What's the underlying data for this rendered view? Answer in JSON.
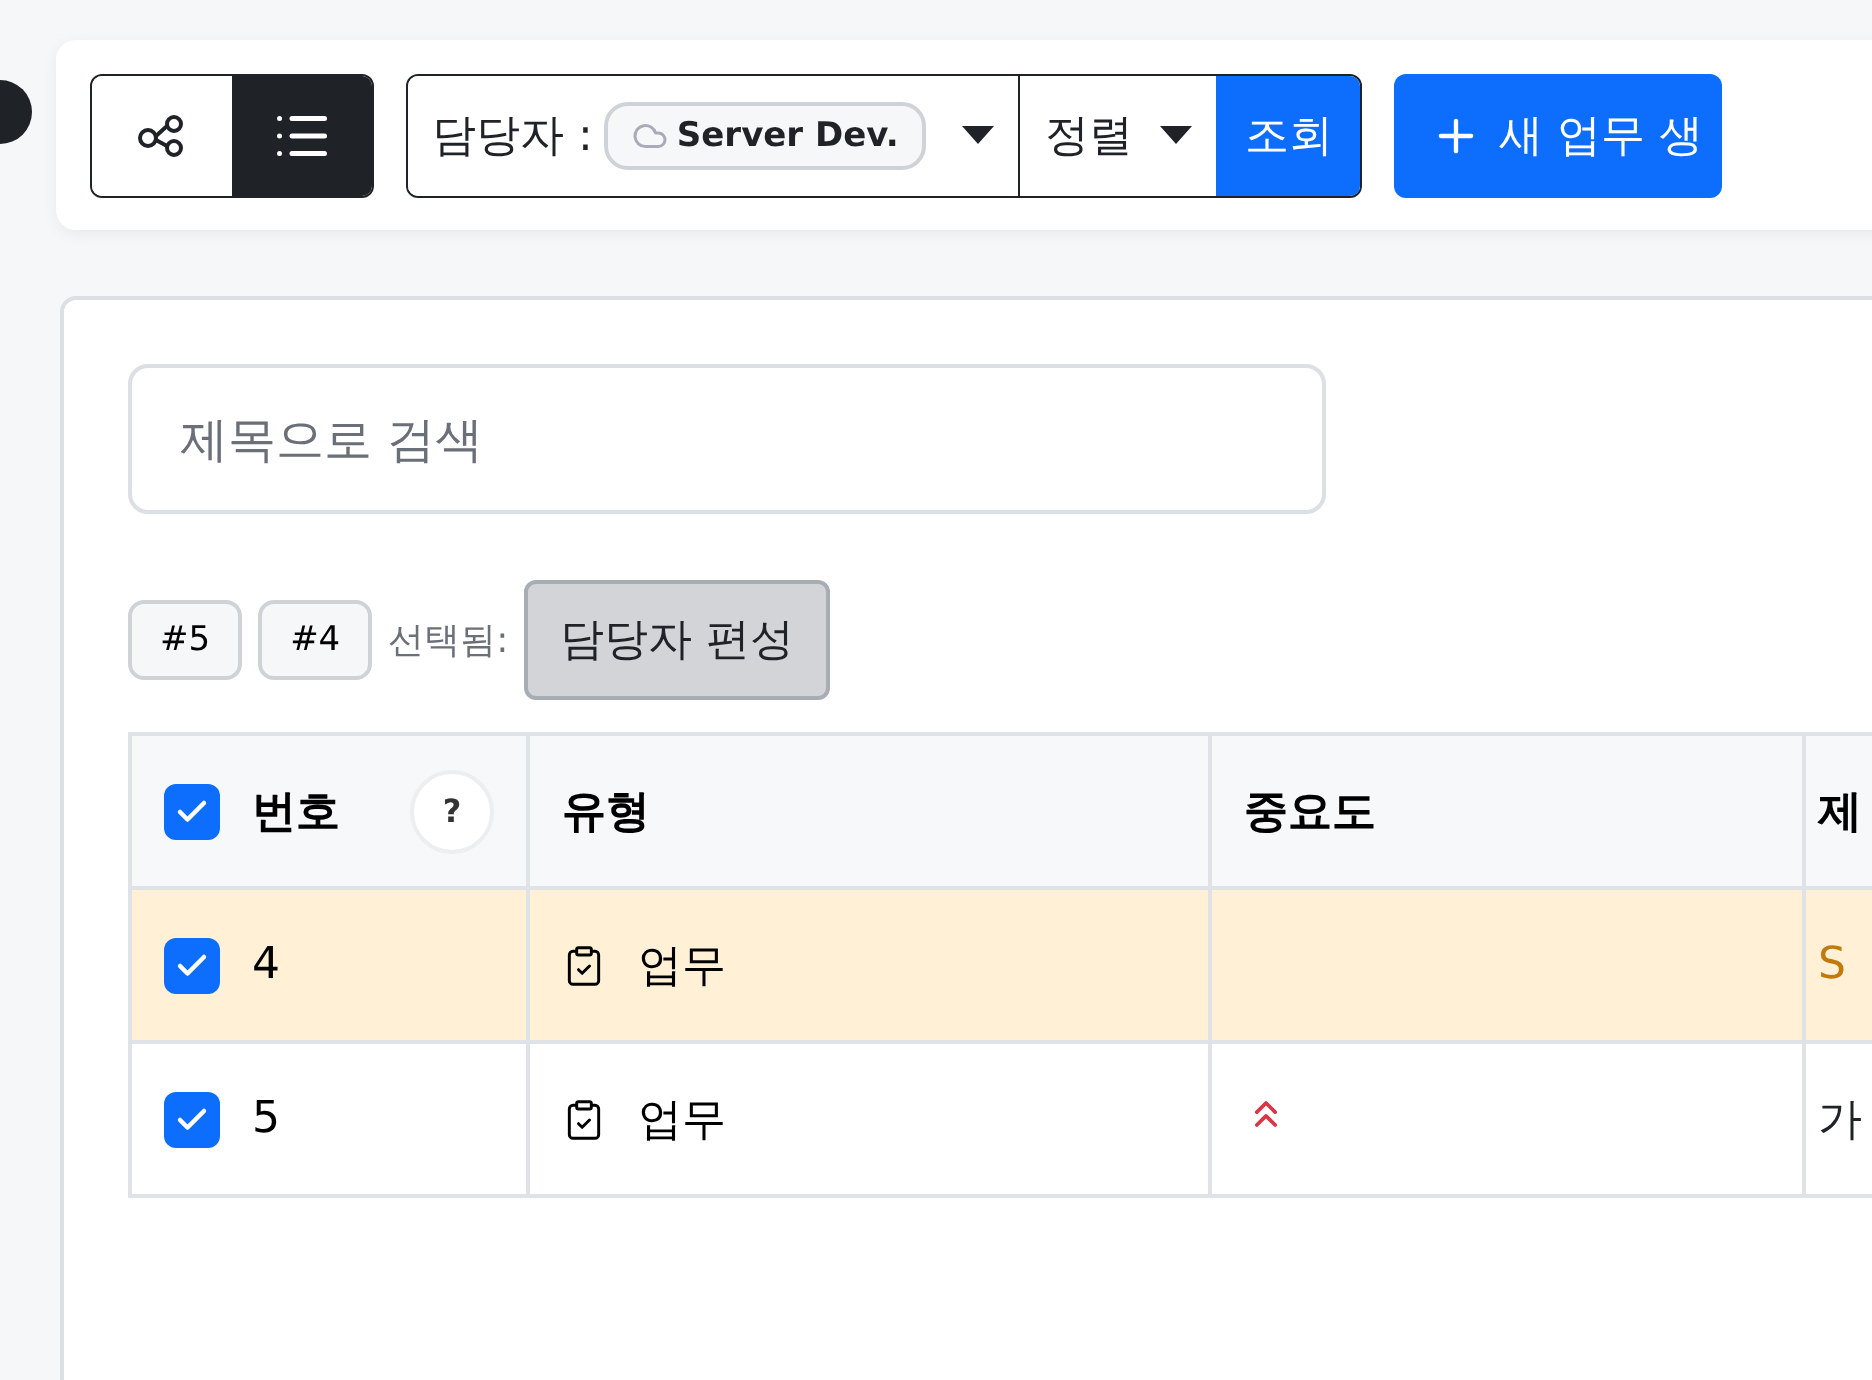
{
  "view_toggle": [
    {
      "kind": "graph",
      "selected": false
    },
    {
      "kind": "list",
      "selected": true
    }
  ],
  "filter": {
    "assignee_label": "담당자 :",
    "assignee_chip": "Server Dev.",
    "sort_label": "정렬",
    "search_button": "조회"
  },
  "create_button": "새 업무 생",
  "search": {
    "placeholder": "제목으로 검색"
  },
  "selection": {
    "chips": [
      "#5",
      "#4"
    ],
    "label": "선택됨:",
    "action_button": "담당자 편성"
  },
  "table": {
    "all_checked": true,
    "help": "?",
    "columns": [
      "번호",
      "유형",
      "중요도",
      "제"
    ],
    "rows": [
      {
        "checked": true,
        "highlighted": true,
        "number": "4",
        "type": "업무",
        "high_priority": false,
        "title": "S"
      },
      {
        "checked": true,
        "highlighted": false,
        "number": "5",
        "type": "업무",
        "high_priority": true,
        "title": "가"
      }
    ]
  }
}
